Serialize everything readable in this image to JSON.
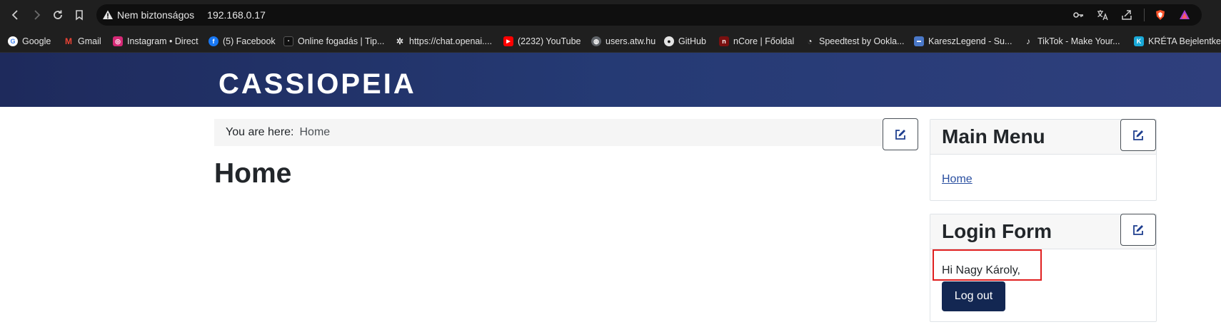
{
  "browser": {
    "security_label": "Nem biztonságos",
    "url": "192.168.0.17",
    "bookmarks": [
      {
        "label": "Google",
        "icon": "google-icon",
        "color": "#ffffff"
      },
      {
        "label": "Gmail",
        "icon": "gmail-icon",
        "color": "#ea4335"
      },
      {
        "label": "Instagram • Direct",
        "icon": "instagram-icon",
        "color": "#d62976"
      },
      {
        "label": "(5) Facebook",
        "icon": "facebook-icon",
        "color": "#1877f2"
      },
      {
        "label": "Online fogadás | Tip...",
        "icon": "betting-icon",
        "color": "#111111"
      },
      {
        "label": "https://chat.openai....",
        "icon": "openai-icon",
        "color": "#2b2b2b"
      },
      {
        "label": "(2232) YouTube",
        "icon": "youtube-icon",
        "color": "#ff0000"
      },
      {
        "label": "users.atw.hu",
        "icon": "globe-icon",
        "color": "#5f6368"
      },
      {
        "label": "GitHub",
        "icon": "github-icon",
        "color": "#2b2b2b"
      },
      {
        "label": "nCore | Főoldal",
        "icon": "ncore-icon",
        "color": "#7a1010"
      },
      {
        "label": "Speedtest by Ookla...",
        "icon": "speedtest-icon",
        "color": "#2b2b2b"
      },
      {
        "label": "KareszLegend - Su...",
        "icon": "bookmark-site-icon",
        "color": "#4a78c8"
      },
      {
        "label": "TikTok - Make Your...",
        "icon": "tiktok-icon",
        "color": "#111111"
      },
      {
        "label": "KRÉTA Bejelentkezés",
        "icon": "kreta-icon",
        "color": "#19a9d8"
      }
    ]
  },
  "site": {
    "brand": "CASSIOPEIA",
    "header_color": "#1e2a5c"
  },
  "breadcrumb": {
    "label": "You are here:",
    "current": "Home"
  },
  "page": {
    "title": "Home"
  },
  "main_menu": {
    "title": "Main Menu",
    "items": [
      {
        "label": "Home"
      }
    ]
  },
  "login_form": {
    "title": "Login Form",
    "greeting": "Hi Nagy Károly,",
    "logout_label": "Log out"
  }
}
